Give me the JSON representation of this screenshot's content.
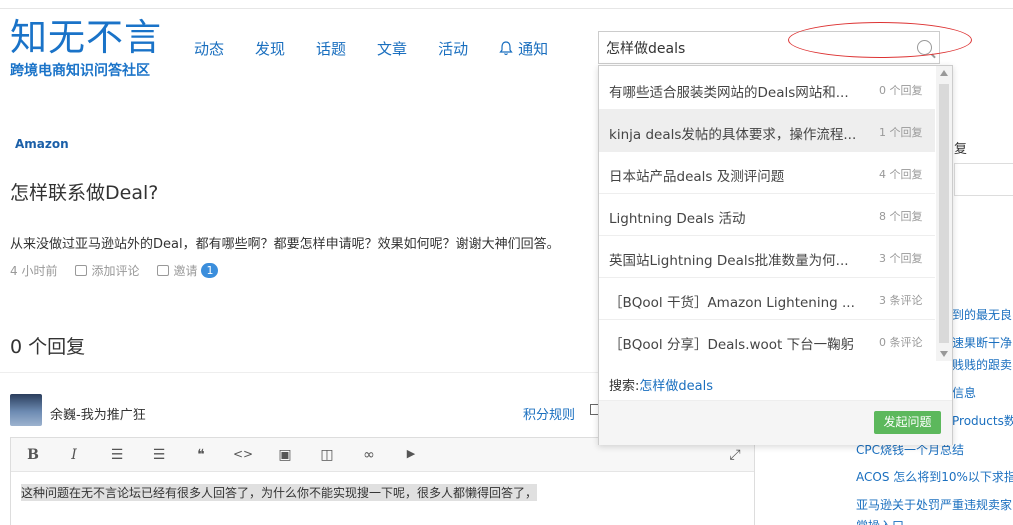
{
  "logo": {
    "main": "知无不言",
    "sub": "跨境电商知识问答社区"
  },
  "nav": {
    "items": [
      "动态",
      "发现",
      "话题",
      "文章",
      "活动"
    ],
    "notify": "通知"
  },
  "search": {
    "value": "怎样做deals"
  },
  "question": {
    "tag": "Amazon",
    "title": "怎样联系做Deal?",
    "body": "从来没做过亚马逊站外的Deal，都有哪些啊？都要怎样申请呢？效果如何呢？谢谢大神们回答。",
    "time": "4 小时前",
    "add_comment": "添加评论",
    "invite": "邀请",
    "invite_count": "1"
  },
  "answers": {
    "count_label": "0 个回复"
  },
  "answer_form": {
    "username": "余巍-我为推广狂",
    "score_rules": "积分规则",
    "editor_text": "这种问题在无不言论坛已经有很多人回答了，为什么你不能实现搜一下呢，很多人都懒得回答了，"
  },
  "toolbar": {
    "bold": "B",
    "italic": "I",
    "ol": "☰",
    "ul": "☰",
    "quote": "❝",
    "code": "<>",
    "image": "▣",
    "attach": "◫",
    "link": "∞",
    "video": "▶",
    "fullscreen": "⤢"
  },
  "right_col": {
    "fu": "复",
    "links": [
      "到的最无良",
      "速果断干净",
      "贱贱的跟卖",
      "信息",
      "Products数",
      "CPC烧钱一个月总结",
      "ACOS 怎么将到10%以下求指",
      "亚马逊关于处罚严重违规卖家",
      "常操入口"
    ]
  },
  "dropdown": {
    "items": [
      {
        "title": "有哪些适合服装类网站的Deals网站和...",
        "count": "0 个回复"
      },
      {
        "title": "kinja deals发帖的具体要求，操作流程...",
        "count": "1 个回复"
      },
      {
        "title": "日本站产品deals 及测评问题",
        "count": "4 个回复"
      },
      {
        "title": "Lightning Deals 活动",
        "count": "8 个回复"
      },
      {
        "title": "英国站Lightning Deals批准数量为何...",
        "count": "3 个回复"
      },
      {
        "title": "［BQool 干货］Amazon Lightening ...",
        "count": "3 条评论"
      },
      {
        "title": "［BQool 分享］Deals.woot 下台一鞠躬",
        "count": "0 条评论"
      }
    ],
    "search_prefix": "搜索:",
    "search_keyword": "怎样做deals",
    "ask_button": "发起问题"
  },
  "colors": {
    "brand": "#1a73c8",
    "link": "#1a6fbf",
    "ask_button": "#5cb85c",
    "annotation": "#dd3333"
  }
}
